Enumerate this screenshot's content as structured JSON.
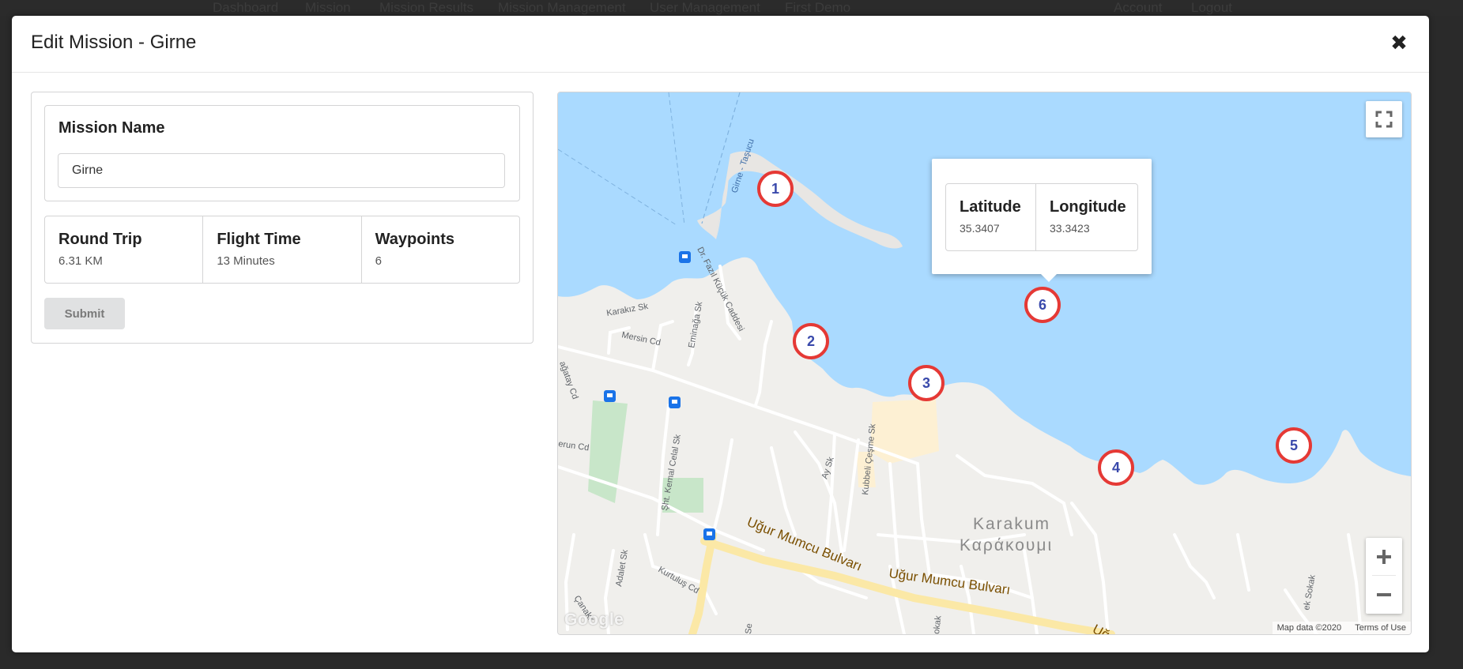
{
  "topnav": {
    "items": [
      "Dashboard",
      "Mission",
      "Mission Results",
      "Mission Management",
      "User Management",
      "First Demo"
    ],
    "right_items": [
      "Account",
      "Logout"
    ]
  },
  "modal": {
    "title": "Edit Mission - Girne",
    "close_icon": "close-icon"
  },
  "form": {
    "mission_name_label": "Mission Name",
    "mission_name_value": "Girne",
    "stats": [
      {
        "label": "Round Trip",
        "value": "6.31 KM"
      },
      {
        "label": "Flight Time",
        "value": "13 Minutes"
      },
      {
        "label": "Waypoints",
        "value": "6"
      }
    ],
    "submit_label": "Submit"
  },
  "map": {
    "waypoints": [
      "1",
      "2",
      "3",
      "4",
      "5",
      "6"
    ],
    "info_window": {
      "lat_label": "Latitude",
      "lat_value": "35.3407",
      "lng_label": "Longitude",
      "lng_value": "33.3423"
    },
    "zoom_in_icon": "plus-icon",
    "zoom_out_icon": "minus-icon",
    "fullscreen_icon": "fullscreen-icon",
    "logo": "Google",
    "attribution": "Map data ©2020",
    "terms": "Terms of Use",
    "place_labels": {
      "district": "Karakum",
      "district_greek": "Καράκουμι",
      "boulevard_1": "Uğur Mumcu Bulvarı",
      "boulevard_2": "Uğur Mumcu Bulvarı",
      "boulevard_3": "Uğ",
      "ferry_route": "Girne - Taşucu",
      "street_fazil": "Dr. Fazıl Küçük Caddesi",
      "street_mersin": "Mersin Cd",
      "street_karakiz": "Karakız Sk",
      "street_eminaga": "Eminağa Sk",
      "street_cagatay": "ağatay Cd",
      "street_kemal": "Şht. Kemal Celal Sk",
      "street_erun": "erun Cd",
      "street_adalet": "Adalet Sk",
      "street_kurtulus": "Kurtuluş Cd",
      "street_canakkale": "Çanakk",
      "street_ay": "Ay Sk",
      "street_kubbeli": "Kubbeli Çeşme Sk",
      "street_sokak": "ek Sokak",
      "street_okak": "okak",
      "street_se": "Se"
    }
  },
  "colors": {
    "water": "#aadaff",
    "land": "#f0efec",
    "waypoint_border": "#e53935",
    "waypoint_text": "#3949ab",
    "road_major": "#fbe8a6"
  }
}
